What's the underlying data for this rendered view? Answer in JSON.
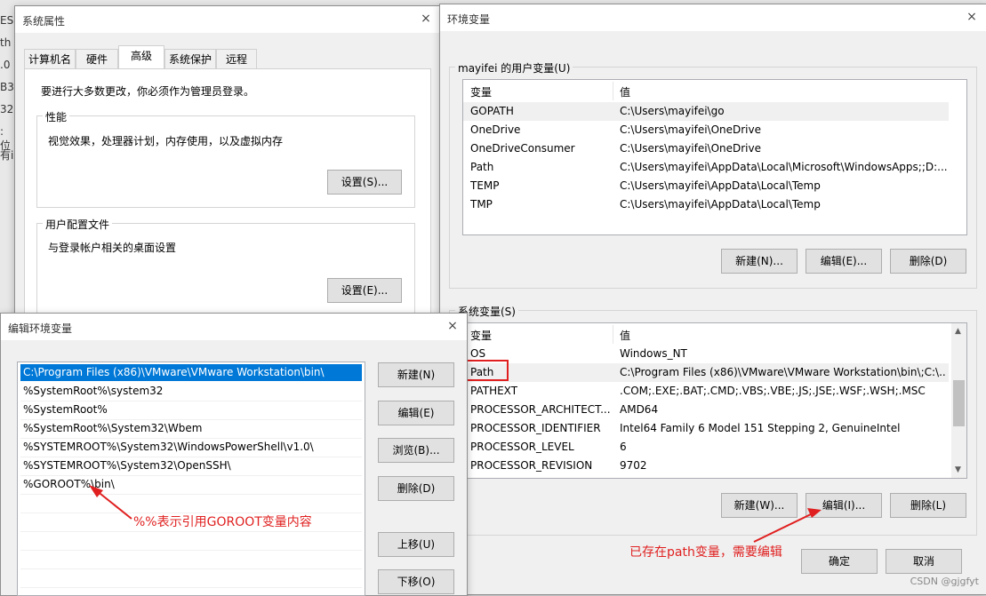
{
  "left_edge_fragments": [
    "ESK",
    "th",
    ".0",
    "B3",
    "32",
    ": 位",
    "有i"
  ],
  "sys_props": {
    "title": "系统属性",
    "close": "×",
    "tabs": [
      "计算机名",
      "硬件",
      "高级",
      "系统保护",
      "远程"
    ],
    "active_tab": "高级",
    "admin_note": "要进行大多数更改，你必须作为管理员登录。",
    "perf_label": "性能",
    "perf_desc": "视觉效果，处理器计划，内存使用，以及虚拟内存",
    "perf_btn": "设置(S)...",
    "profile_label": "用户配置文件",
    "profile_desc": "与登录帐户相关的桌面设置",
    "profile_btn": "设置(E)..."
  },
  "env_vars": {
    "title": "环境变量",
    "close": "×",
    "user_group": "mayifei 的用户变量(U)",
    "col_var": "变量",
    "col_val": "值",
    "user_vars": [
      {
        "name": "GOPATH",
        "value": "C:\\Users\\mayifei\\go"
      },
      {
        "name": "OneDrive",
        "value": "C:\\Users\\mayifei\\OneDrive"
      },
      {
        "name": "OneDriveConsumer",
        "value": "C:\\Users\\mayifei\\OneDrive"
      },
      {
        "name": "Path",
        "value": "C:\\Users\\mayifei\\AppData\\Local\\Microsoft\\WindowsApps;;D:..."
      },
      {
        "name": "TEMP",
        "value": "C:\\Users\\mayifei\\AppData\\Local\\Temp"
      },
      {
        "name": "TMP",
        "value": "C:\\Users\\mayifei\\AppData\\Local\\Temp"
      }
    ],
    "user_btns": [
      "新建(N)...",
      "编辑(E)...",
      "删除(D)"
    ],
    "sys_group": "系统变量(S)",
    "sys_vars": [
      {
        "name": "OS",
        "value": "Windows_NT"
      },
      {
        "name": "Path",
        "value": "C:\\Program Files (x86)\\VMware\\VMware Workstation\\bin\\;C:\\..."
      },
      {
        "name": "PATHEXT",
        "value": ".COM;.EXE;.BAT;.CMD;.VBS;.VBE;.JS;.JSE;.WSF;.WSH;.MSC"
      },
      {
        "name": "PROCESSOR_ARCHITECT...",
        "value": "AMD64"
      },
      {
        "name": "PROCESSOR_IDENTIFIER",
        "value": "Intel64 Family 6 Model 151 Stepping 2, GenuineIntel"
      },
      {
        "name": "PROCESSOR_LEVEL",
        "value": "6"
      },
      {
        "name": "PROCESSOR_REVISION",
        "value": "9702"
      }
    ],
    "sys_btns": [
      "新建(W)...",
      "编辑(I)...",
      "删除(L)"
    ],
    "ok": "确定",
    "cancel": "取消"
  },
  "edit_env": {
    "title": "编辑环境变量",
    "close": "×",
    "entries": [
      "C:\\Program Files (x86)\\VMware\\VMware Workstation\\bin\\",
      "%SystemRoot%\\system32",
      "%SystemRoot%",
      "%SystemRoot%\\System32\\Wbem",
      "%SYSTEMROOT%\\System32\\WindowsPowerShell\\v1.0\\",
      "%SYSTEMROOT%\\System32\\OpenSSH\\",
      "%GOROOT%\\bin\\"
    ],
    "btns": [
      "新建(N)",
      "编辑(E)",
      "浏览(B)...",
      "删除(D)",
      "上移(U)",
      "下移(O)"
    ]
  },
  "annotations": {
    "goroot_note": "%%表示引用GOROOT变量内容",
    "path_note": "已存在path变量，需要编辑"
  },
  "watermark": "CSDN @gjgfyt",
  "colors": {
    "annotation": "#e02020",
    "selection": "#0078d7"
  }
}
